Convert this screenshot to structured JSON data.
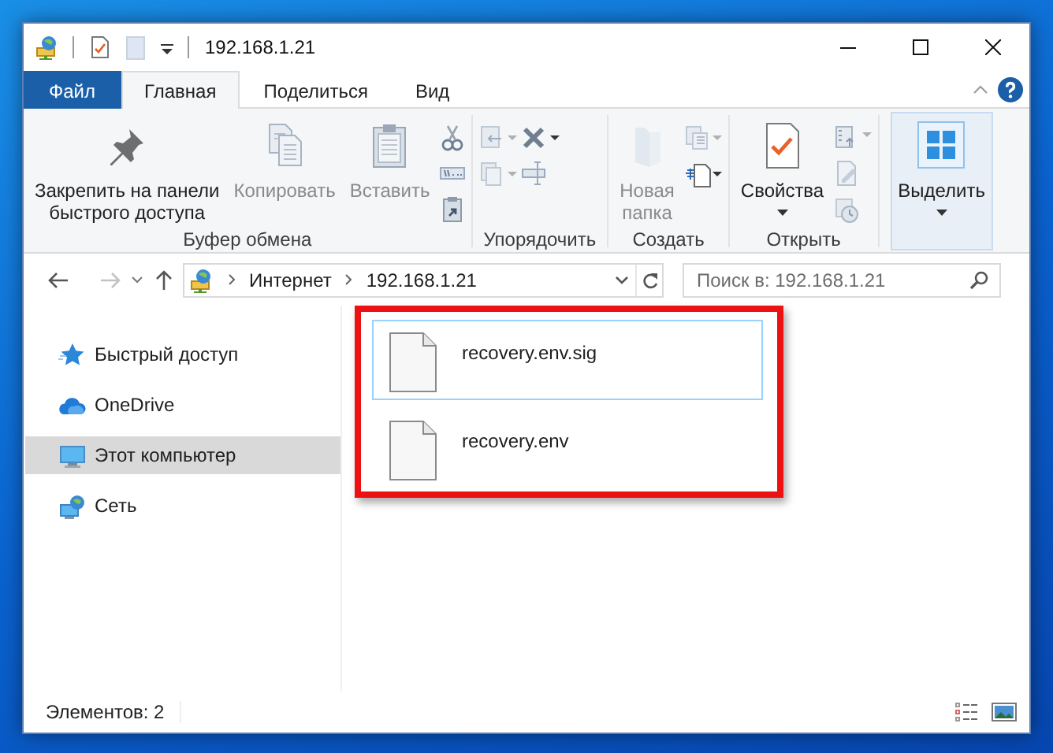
{
  "window": {
    "title": "192.168.1.21"
  },
  "tabs": [
    {
      "label": "Файл",
      "kind": "file",
      "selected": false
    },
    {
      "label": "Главная",
      "kind": "tab",
      "selected": true
    },
    {
      "label": "Поделиться",
      "kind": "tab",
      "selected": false
    },
    {
      "label": "Вид",
      "kind": "tab",
      "selected": false
    }
  ],
  "ribbon": {
    "groups": [
      {
        "label": "Буфер обмена",
        "commands": [
          {
            "label": "Закрепить на панели\nбыстрого доступа",
            "kind": "pin",
            "disabled": false
          },
          {
            "label": "Копировать",
            "kind": "copy",
            "disabled": true
          },
          {
            "label": "Вставить",
            "kind": "paste",
            "disabled": true
          }
        ]
      },
      {
        "label": "Упорядочить"
      },
      {
        "label": "Создать",
        "commands": [
          {
            "label": "Новая\nпапка",
            "kind": "folder",
            "disabled": true
          }
        ]
      },
      {
        "label": "Открыть",
        "commands": [
          {
            "label": "Свойства",
            "kind": "properties",
            "disabled": false,
            "dropdown": true
          }
        ]
      },
      {
        "commands": [
          {
            "label": "Выделить",
            "kind": "select",
            "disabled": false,
            "dropdown": true,
            "highlighted": true
          }
        ]
      }
    ]
  },
  "address": {
    "path": [
      "Интернет",
      "192.168.1.21"
    ]
  },
  "search": {
    "placeholder": "Поиск в: 192.168.1.21"
  },
  "nav": {
    "items": [
      {
        "label": "Быстрый доступ",
        "kind": "quick_access",
        "selected": false
      },
      {
        "label": "OneDrive",
        "kind": "cloud",
        "selected": false
      },
      {
        "label": "Этот компьютер",
        "kind": "computer",
        "selected": true
      },
      {
        "label": "Сеть",
        "kind": "network",
        "selected": false
      }
    ]
  },
  "file_list": {
    "highlighted": true,
    "files": [
      {
        "name": "recovery.env.sig",
        "selected": true
      },
      {
        "name": "recovery.env",
        "selected": false
      }
    ]
  },
  "status_bar": {
    "text": "Элементов: 2"
  }
}
